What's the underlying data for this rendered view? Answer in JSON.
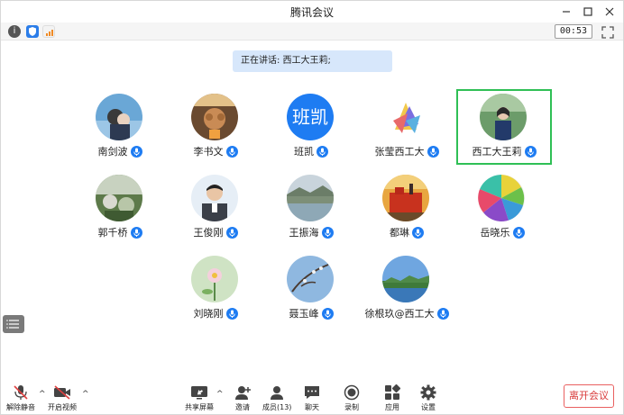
{
  "window": {
    "title": "腾讯会议"
  },
  "infobar": {
    "timer": "00:53"
  },
  "speaking": {
    "text": "正在讲话: 西工大王莉;"
  },
  "participants": [
    {
      "name": "南剑波"
    },
    {
      "name": "李书文"
    },
    {
      "name": "班凯",
      "avatar_text": "班凯"
    },
    {
      "name": "张莹西工大"
    },
    {
      "name": "西工大王莉",
      "active": true
    },
    {
      "name": "郭千桥"
    },
    {
      "name": "王俊刚"
    },
    {
      "name": "王振海"
    },
    {
      "name": "都琳"
    },
    {
      "name": "岳晓乐"
    },
    {
      "name": "刘晓刚"
    },
    {
      "name": "聂玉峰"
    },
    {
      "name": "徐根玖@西工大"
    }
  ],
  "toolbar": {
    "unmute": "解除静音",
    "start_video": "开启视频",
    "share_screen": "共享屏幕",
    "invite": "邀请",
    "members": "成员(13)",
    "chat": "聊天",
    "record": "录制",
    "apps": "应用",
    "settings": "设置",
    "leave": "离开会议"
  },
  "colors": {
    "accent": "#1e7cf2",
    "active_border": "#2fbf55",
    "leave": "#d83a3a"
  }
}
